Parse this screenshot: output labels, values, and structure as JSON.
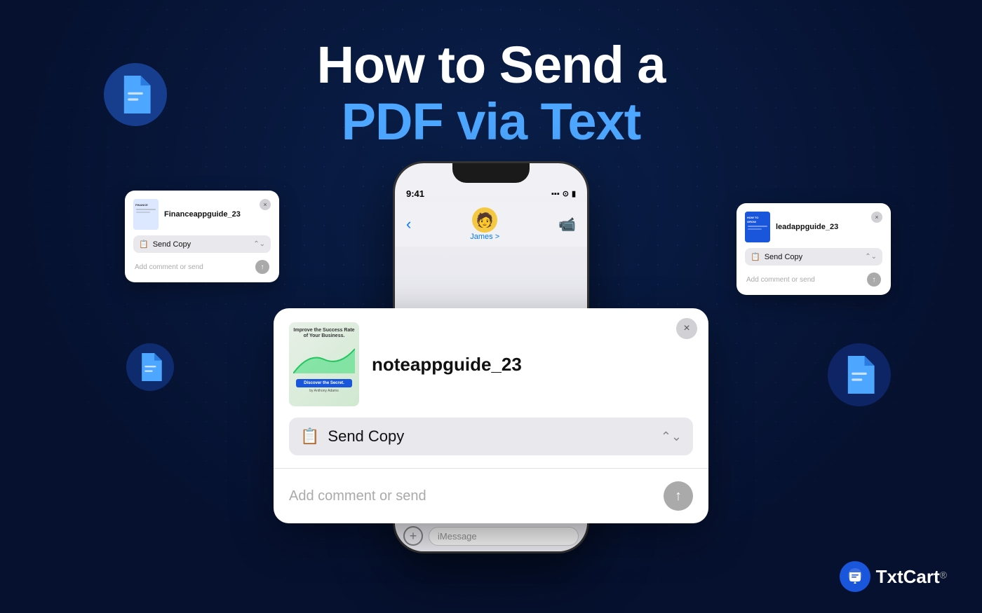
{
  "page": {
    "background_color": "#0a1a3a"
  },
  "headline": {
    "line1": "How to Send a",
    "line2": "PDF via Text"
  },
  "main_card": {
    "filename": "noteappguide_23",
    "action_label": "Send Copy",
    "comment_placeholder": "Add comment or send",
    "close_button": "×",
    "thumb_title": "Improve the Success Rate of Your Business.",
    "thumb_cta": "Discover the Secret."
  },
  "mini_card_left": {
    "filename": "Financeappguide_23",
    "action_label": "Send Copy",
    "comment_placeholder": "Add comment or send",
    "close_button": "×"
  },
  "mini_card_right": {
    "filename": "leadappguide_23",
    "action_label": "Send Copy",
    "comment_placeholder": "Add comment or send",
    "close_button": "×"
  },
  "phone": {
    "status_time": "9:41",
    "contact_name": "James >",
    "imessage_placeholder": "iMessage",
    "back_arrow": "‹",
    "plus_icon": "+"
  },
  "txtcart": {
    "name": "TxtCart",
    "registered": "®",
    "icon": "💬"
  },
  "doc_icons": {
    "tl_icon": "📄",
    "ml_icon": "📄",
    "mr_icon": "📄"
  }
}
